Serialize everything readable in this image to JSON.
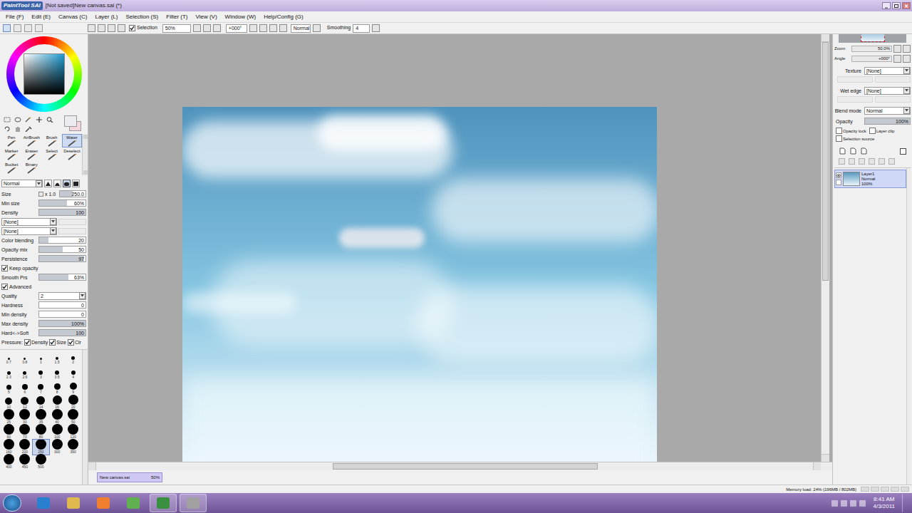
{
  "window": {
    "logo": "PaintTool SAI",
    "title": "[Not saved]New canvas.sai (*)"
  },
  "menu": [
    "File (F)",
    "Edit (E)",
    "Canvas (C)",
    "Layer (L)",
    "Selection (S)",
    "Filter (T)",
    "View (V)",
    "Window (W)",
    "Help/Config (G)"
  ],
  "toolbar": {
    "selection": {
      "label": "Selection",
      "checked": true
    },
    "zoom": "50%",
    "angle": "+000°",
    "blend": "Normal",
    "smoothing": {
      "label": "Smoothing",
      "value": "4"
    }
  },
  "colors": {
    "hue": "#1e9ad0",
    "primary": "#ececf0",
    "secondary": "#f6d6de"
  },
  "tools": [
    {
      "label": "Pen",
      "selected": false
    },
    {
      "label": "AirBrush",
      "selected": false
    },
    {
      "label": "Brush",
      "selected": false
    },
    {
      "label": "Water",
      "selected": true
    },
    {
      "label": "Marker",
      "selected": false
    },
    {
      "label": "Eraser",
      "selected": false
    },
    {
      "label": "Select",
      "selected": false
    },
    {
      "label": "Deselect",
      "selected": false
    },
    {
      "label": "Bucket",
      "selected": false
    },
    {
      "label": "Binary",
      "selected": false
    }
  ],
  "brush": {
    "blend": "Normal",
    "shapes": [
      {
        "selected": false
      },
      {
        "selected": false
      },
      {
        "selected": true
      },
      {
        "selected": false
      }
    ],
    "params": [
      {
        "kind": "slider",
        "label": "Size",
        "extra": "x 1.0",
        "value": "250.0",
        "level": 0.5
      },
      {
        "kind": "slider",
        "label": "Min size",
        "value": "60%",
        "level": 0.6
      },
      {
        "kind": "slider",
        "label": "Density",
        "value": "100",
        "level": 1
      },
      {
        "kind": "dropdown",
        "label": "",
        "value": "[None]"
      },
      {
        "kind": "dropdown",
        "label": "",
        "value": "[None]"
      },
      {
        "kind": "slider",
        "label": "Color blending",
        "value": "20",
        "level": 0.2
      },
      {
        "kind": "slider",
        "label": "Opacity mix",
        "value": "50",
        "level": 0.5
      },
      {
        "kind": "slider",
        "label": "Persistence",
        "value": "97",
        "level": 0.97
      },
      {
        "kind": "checkbox",
        "label": "Keep opacity",
        "checked": true
      },
      {
        "kind": "slider",
        "label": "Smooth Prs",
        "value": "63%",
        "level": 0.63
      },
      {
        "kind": "checkbox",
        "label": "Advanced",
        "checked": true
      },
      {
        "kind": "dropdown",
        "label": "Quality",
        "value": "2"
      },
      {
        "kind": "slider",
        "label": "Hardness",
        "value": "0",
        "level": 0
      },
      {
        "kind": "slider",
        "label": "Min density",
        "value": "0",
        "level": 0
      },
      {
        "kind": "slider",
        "label": "Max density",
        "value": "100%",
        "level": 1
      },
      {
        "kind": "slider",
        "label": "Hard<->Soft",
        "value": "100",
        "level": 1
      }
    ],
    "pressure": {
      "label": "Pressure:",
      "options": [
        {
          "label": "Density",
          "checked": true
        },
        {
          "label": "Size",
          "checked": true
        },
        {
          "label": "Clr",
          "checked": true
        }
      ]
    },
    "sizes": [
      {
        "label": "0.7",
        "selected": false
      },
      {
        "label": "0.8",
        "selected": false
      },
      {
        "label": "1",
        "selected": false
      },
      {
        "label": "1.5",
        "selected": false
      },
      {
        "label": "2",
        "selected": false
      },
      {
        "label": "2.3",
        "selected": false
      },
      {
        "label": "2.6",
        "selected": false
      },
      {
        "label": "3",
        "selected": false
      },
      {
        "label": "3.5",
        "selected": false
      },
      {
        "label": "4",
        "selected": false
      },
      {
        "label": "5",
        "selected": false
      },
      {
        "label": "6",
        "selected": false
      },
      {
        "label": "7",
        "selected": false
      },
      {
        "label": "8",
        "selected": false
      },
      {
        "label": "9",
        "selected": false
      },
      {
        "label": "10",
        "selected": false
      },
      {
        "label": "12",
        "selected": false
      },
      {
        "label": "14",
        "selected": false
      },
      {
        "label": "16",
        "selected": false
      },
      {
        "label": "20",
        "selected": false
      },
      {
        "label": "25",
        "selected": false
      },
      {
        "label": "30",
        "selected": false
      },
      {
        "label": "35",
        "selected": false
      },
      {
        "label": "40",
        "selected": false
      },
      {
        "label": "50",
        "selected": false
      },
      {
        "label": "60",
        "selected": false
      },
      {
        "label": "70",
        "selected": false
      },
      {
        "label": "80",
        "selected": false
      },
      {
        "label": "100",
        "selected": false
      },
      {
        "label": "120",
        "selected": false
      },
      {
        "label": "160",
        "selected": false
      },
      {
        "label": "200",
        "selected": false
      },
      {
        "label": "250",
        "selected": true
      },
      {
        "label": "300",
        "selected": false
      },
      {
        "label": "350",
        "selected": false
      },
      {
        "label": "400",
        "selected": false
      },
      {
        "label": "450",
        "selected": false
      },
      {
        "label": "500",
        "selected": false
      }
    ]
  },
  "navigator": {
    "zoom": {
      "label": "Zoom",
      "value": "50.0%"
    },
    "angle": {
      "label": "Angle",
      "value": "+000°"
    }
  },
  "layer_panel": {
    "texture": {
      "label": "Texture",
      "value": "[None]"
    },
    "wet_edge": {
      "label": "Wet edge",
      "value": "[None]"
    },
    "blend": {
      "label": "Blend mode",
      "value": "Normal"
    },
    "opacity": {
      "label": "Opacity",
      "value": "100%",
      "level": 1
    },
    "options": [
      {
        "label": "Opacity lock",
        "checked": false
      },
      {
        "label": "Layer clip",
        "checked": false
      },
      {
        "label": "Selection source",
        "checked": false
      }
    ],
    "layers": [
      {
        "name": "Layer1",
        "mode": "Normal",
        "opacity": "100%",
        "visible": true,
        "selected": true
      }
    ]
  },
  "canvas_tabs": [
    {
      "name": "New canvas.sai",
      "zoom": "50%",
      "selected": true
    }
  ],
  "scroll": {
    "horizontal": {
      "start": 0.33,
      "size": 0.37
    },
    "vertical": {
      "start": 0.0,
      "size": 0.58
    }
  },
  "status_bar": {
    "memory": "Memory load: 24% (196MB / 802MB)"
  },
  "taskbar": {
    "time": "8:41 AM",
    "date": "4/3/2011"
  }
}
